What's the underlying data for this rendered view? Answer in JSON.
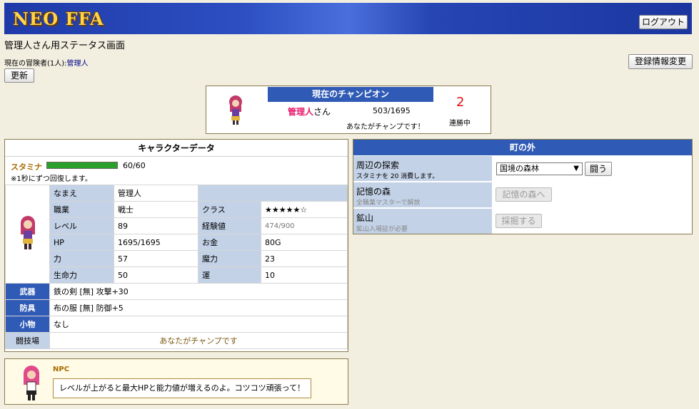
{
  "header": {
    "logo": "NEO FFA",
    "logout_label": "ログアウト"
  },
  "page": {
    "title": "管理人さん用ステータス画面",
    "adventurers_label": "現在の冒険者(1人):",
    "adventurers_user": "管理人",
    "refresh_label": "更新",
    "edit_info_label": "登録情報変更"
  },
  "champion": {
    "heading": "現在のチャンピオン",
    "name": "管理人",
    "suffix": "さん",
    "hp": "503/1695",
    "you_text": "あなたがチャンプです！",
    "streak": "2",
    "streak_label": "連勝中"
  },
  "character": {
    "heading": "キャラクターデータ",
    "stamina_label": "スタミナ",
    "stamina_value": "60/60",
    "stamina_note": "※1秒にずつ回復します。",
    "stats": {
      "name_k": "なまえ",
      "name_v": "管理人",
      "job_k": "職業",
      "job_v": "戦士",
      "class_k": "クラス",
      "class_v": "★★★★★☆",
      "level_k": "レベル",
      "level_v": "89",
      "exp_k": "経験値",
      "exp_v": "474/900",
      "hp_k": "HP",
      "hp_v": "1695/1695",
      "gold_k": "お金",
      "gold_v": "80G",
      "str_k": "力",
      "str_v": "57",
      "mag_k": "魔力",
      "mag_v": "23",
      "vit_k": "生命力",
      "vit_v": "50",
      "luck_k": "運",
      "luck_v": "10"
    },
    "equip": {
      "weapon_k": "武器",
      "weapon_v": "鉄の剣 [無] 攻撃+30",
      "armor_k": "防具",
      "armor_v": "布の服 [無] 防御+5",
      "item_k": "小物",
      "item_v": "なし",
      "arena_k": "闘技場",
      "arena_v": "あなたがチャンプです"
    }
  },
  "town": {
    "heading": "町の外",
    "explore_title": "周辺の探索",
    "explore_sub": "スタミナを 20 消費します。",
    "explore_select": "国境の森林",
    "fight_label": "闘う",
    "memory_title": "記憶の森",
    "memory_sub": "全職業マスターで解放",
    "memory_button": "記憶の森へ",
    "mine_title": "鉱山",
    "mine_sub": "鉱山入場証が必要",
    "mine_button": "採掘する"
  },
  "npc": {
    "label": "NPC",
    "message": "レベルが上がると最大HPと能力値が増えるのよ。コツコツ頑張って！"
  }
}
